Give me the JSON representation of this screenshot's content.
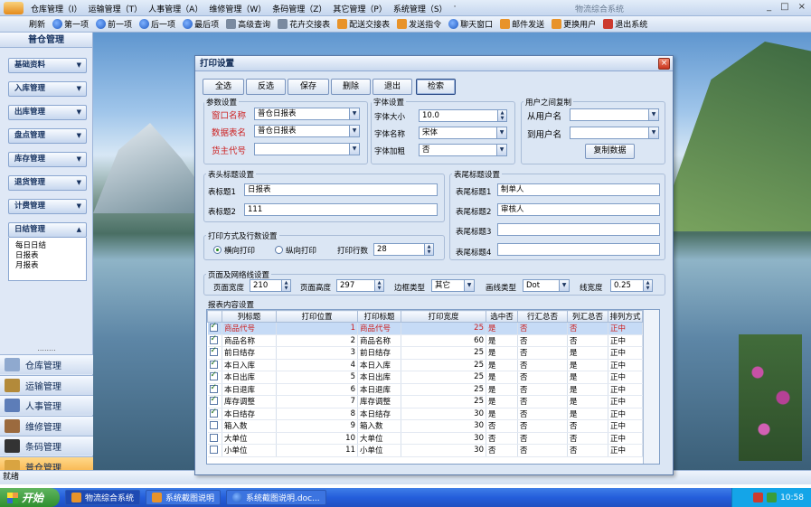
{
  "window": {
    "app_title": "物流综合系统",
    "controls": [
      "_",
      "□",
      "×"
    ],
    "menu": [
      "仓库管理（I）",
      "运输管理（T）",
      "人事管理（A）",
      "维修管理（W）",
      "条码管理（Z）",
      "其它管理（P）",
      "系统管理（S）"
    ],
    "menu_suffix": "·"
  },
  "toolbar": [
    {
      "label": "刷新",
      "icon": "refresh-icon"
    },
    {
      "label": "第一项",
      "icon": "first-icon"
    },
    {
      "label": "前一项",
      "icon": "prev-icon"
    },
    {
      "label": "后一项",
      "icon": "next-icon"
    },
    {
      "label": "最后项",
      "icon": "last-icon"
    },
    {
      "label": "高级查询",
      "icon": "query-icon"
    },
    {
      "label": "花卉交接表",
      "icon": "list-icon"
    },
    {
      "label": "配送交接表",
      "icon": "truck-icon"
    },
    {
      "label": "发送指令",
      "icon": "send-icon"
    },
    {
      "label": "聊天窗口",
      "icon": "chat-icon"
    },
    {
      "label": "邮件发送",
      "icon": "mail-icon"
    },
    {
      "label": "更换用户",
      "icon": "user-icon"
    },
    {
      "label": "退出系统",
      "icon": "exit-icon"
    }
  ],
  "sidebar": {
    "title": "普仓管理",
    "groups": [
      "基础资料",
      "入库管理",
      "出库管理",
      "盘点管理",
      "库存管理",
      "退货管理",
      "计费管理",
      "日结管理"
    ],
    "subitems": [
      "每日日结",
      "日报表",
      "月报表"
    ],
    "nav_dots": "........",
    "nav": [
      "仓库管理",
      "运输管理",
      "人事管理",
      "维修管理",
      "条码管理",
      "普仓管理"
    ]
  },
  "status": "就绪",
  "taskbar": {
    "start": "开始",
    "tasks": [
      "物流综合系统",
      "系统截图说明",
      "系统截图说明.doc..."
    ],
    "clock": "10:58"
  },
  "dialog": {
    "title": "打印设置",
    "close": "×",
    "buttons": [
      "全选",
      "反选",
      "保存",
      "删除",
      "退出",
      "检索"
    ],
    "params": {
      "legend": "参数设置",
      "window_name_label": "窗口名称",
      "window_name": "普仓日报表",
      "table_name_label": "数据表名",
      "table_name": "普仓日报表",
      "owner_label": "货主代号",
      "owner": ""
    },
    "font": {
      "legend": "字体设置",
      "size_label": "字体大小",
      "size": "10.0",
      "name_label": "字体名称",
      "name": "宋体",
      "bold_label": "字体加粗",
      "bold": "否"
    },
    "copy": {
      "legend": "用户之间复制",
      "from_label": "从用户名",
      "from": "",
      "to_label": "到用户名",
      "to": "",
      "button": "复制数据"
    },
    "header": {
      "legend": "表头标题设置",
      "t1_label": "表标题1",
      "t1": "日报表",
      "t2_label": "表标题2",
      "t2": "111"
    },
    "footer": {
      "legend": "表尾标题设置",
      "f1_label": "表尾标题1",
      "f1": "制单人",
      "f2_label": "表尾标题2",
      "f2": "审核人",
      "f3_label": "表尾标题3",
      "f3": "",
      "f4_label": "表尾标题4",
      "f4": ""
    },
    "print": {
      "legend": "打印方式及行数设置",
      "portrait": "横向打印",
      "landscape": "纵向打印",
      "rows_label": "打印行数",
      "rows": "28"
    },
    "page": {
      "legend": "页面及网络线设置",
      "width_label": "页面宽度",
      "width": "210",
      "height_label": "页面高度",
      "height": "297",
      "border_label": "边框类型",
      "border": "其它",
      "line_label": "画线类型",
      "line": "Dot",
      "lw_label": "线宽度",
      "lw": "0.25"
    },
    "content": {
      "legend": "报表内容设置",
      "columns": [
        "",
        "列标题",
        "打印位置",
        "打印标题",
        "打印宽度",
        "选中否",
        "行汇总否",
        "列汇总否",
        "排列方式"
      ],
      "rows": [
        {
          "checked": true,
          "title": "商品代号",
          "pos": "1",
          "ptitle": "商品代号",
          "width": "25",
          "sel": "是",
          "row": "否",
          "col": "否",
          "align": "正中"
        },
        {
          "checked": true,
          "title": "商品名称",
          "pos": "2",
          "ptitle": "商品名称",
          "width": "60",
          "sel": "是",
          "row": "否",
          "col": "否",
          "align": "正中"
        },
        {
          "checked": true,
          "title": "前日结存",
          "pos": "3",
          "ptitle": "前日结存",
          "width": "25",
          "sel": "是",
          "row": "否",
          "col": "是",
          "align": "正中"
        },
        {
          "checked": true,
          "title": "本日入库",
          "pos": "4",
          "ptitle": "本日入库",
          "width": "25",
          "sel": "是",
          "row": "否",
          "col": "是",
          "align": "正中"
        },
        {
          "checked": true,
          "title": "本日出库",
          "pos": "5",
          "ptitle": "本日出库",
          "width": "25",
          "sel": "是",
          "row": "否",
          "col": "是",
          "align": "正中"
        },
        {
          "checked": true,
          "title": "本日退库",
          "pos": "6",
          "ptitle": "本日退库",
          "width": "25",
          "sel": "是",
          "row": "否",
          "col": "是",
          "align": "正中"
        },
        {
          "checked": true,
          "title": "库存调整",
          "pos": "7",
          "ptitle": "库存调整",
          "width": "25",
          "sel": "是",
          "row": "否",
          "col": "是",
          "align": "正中"
        },
        {
          "checked": true,
          "title": "本日结存",
          "pos": "8",
          "ptitle": "本日结存",
          "width": "30",
          "sel": "是",
          "row": "否",
          "col": "是",
          "align": "正中"
        },
        {
          "checked": false,
          "title": "箱入数",
          "pos": "9",
          "ptitle": "箱入数",
          "width": "30",
          "sel": "否",
          "row": "否",
          "col": "否",
          "align": "正中"
        },
        {
          "checked": false,
          "title": "大单位",
          "pos": "10",
          "ptitle": "大单位",
          "width": "30",
          "sel": "否",
          "row": "否",
          "col": "否",
          "align": "正中"
        },
        {
          "checked": false,
          "title": "小单位",
          "pos": "11",
          "ptitle": "小单位",
          "width": "30",
          "sel": "否",
          "row": "否",
          "col": "否",
          "align": "正中"
        }
      ]
    }
  }
}
